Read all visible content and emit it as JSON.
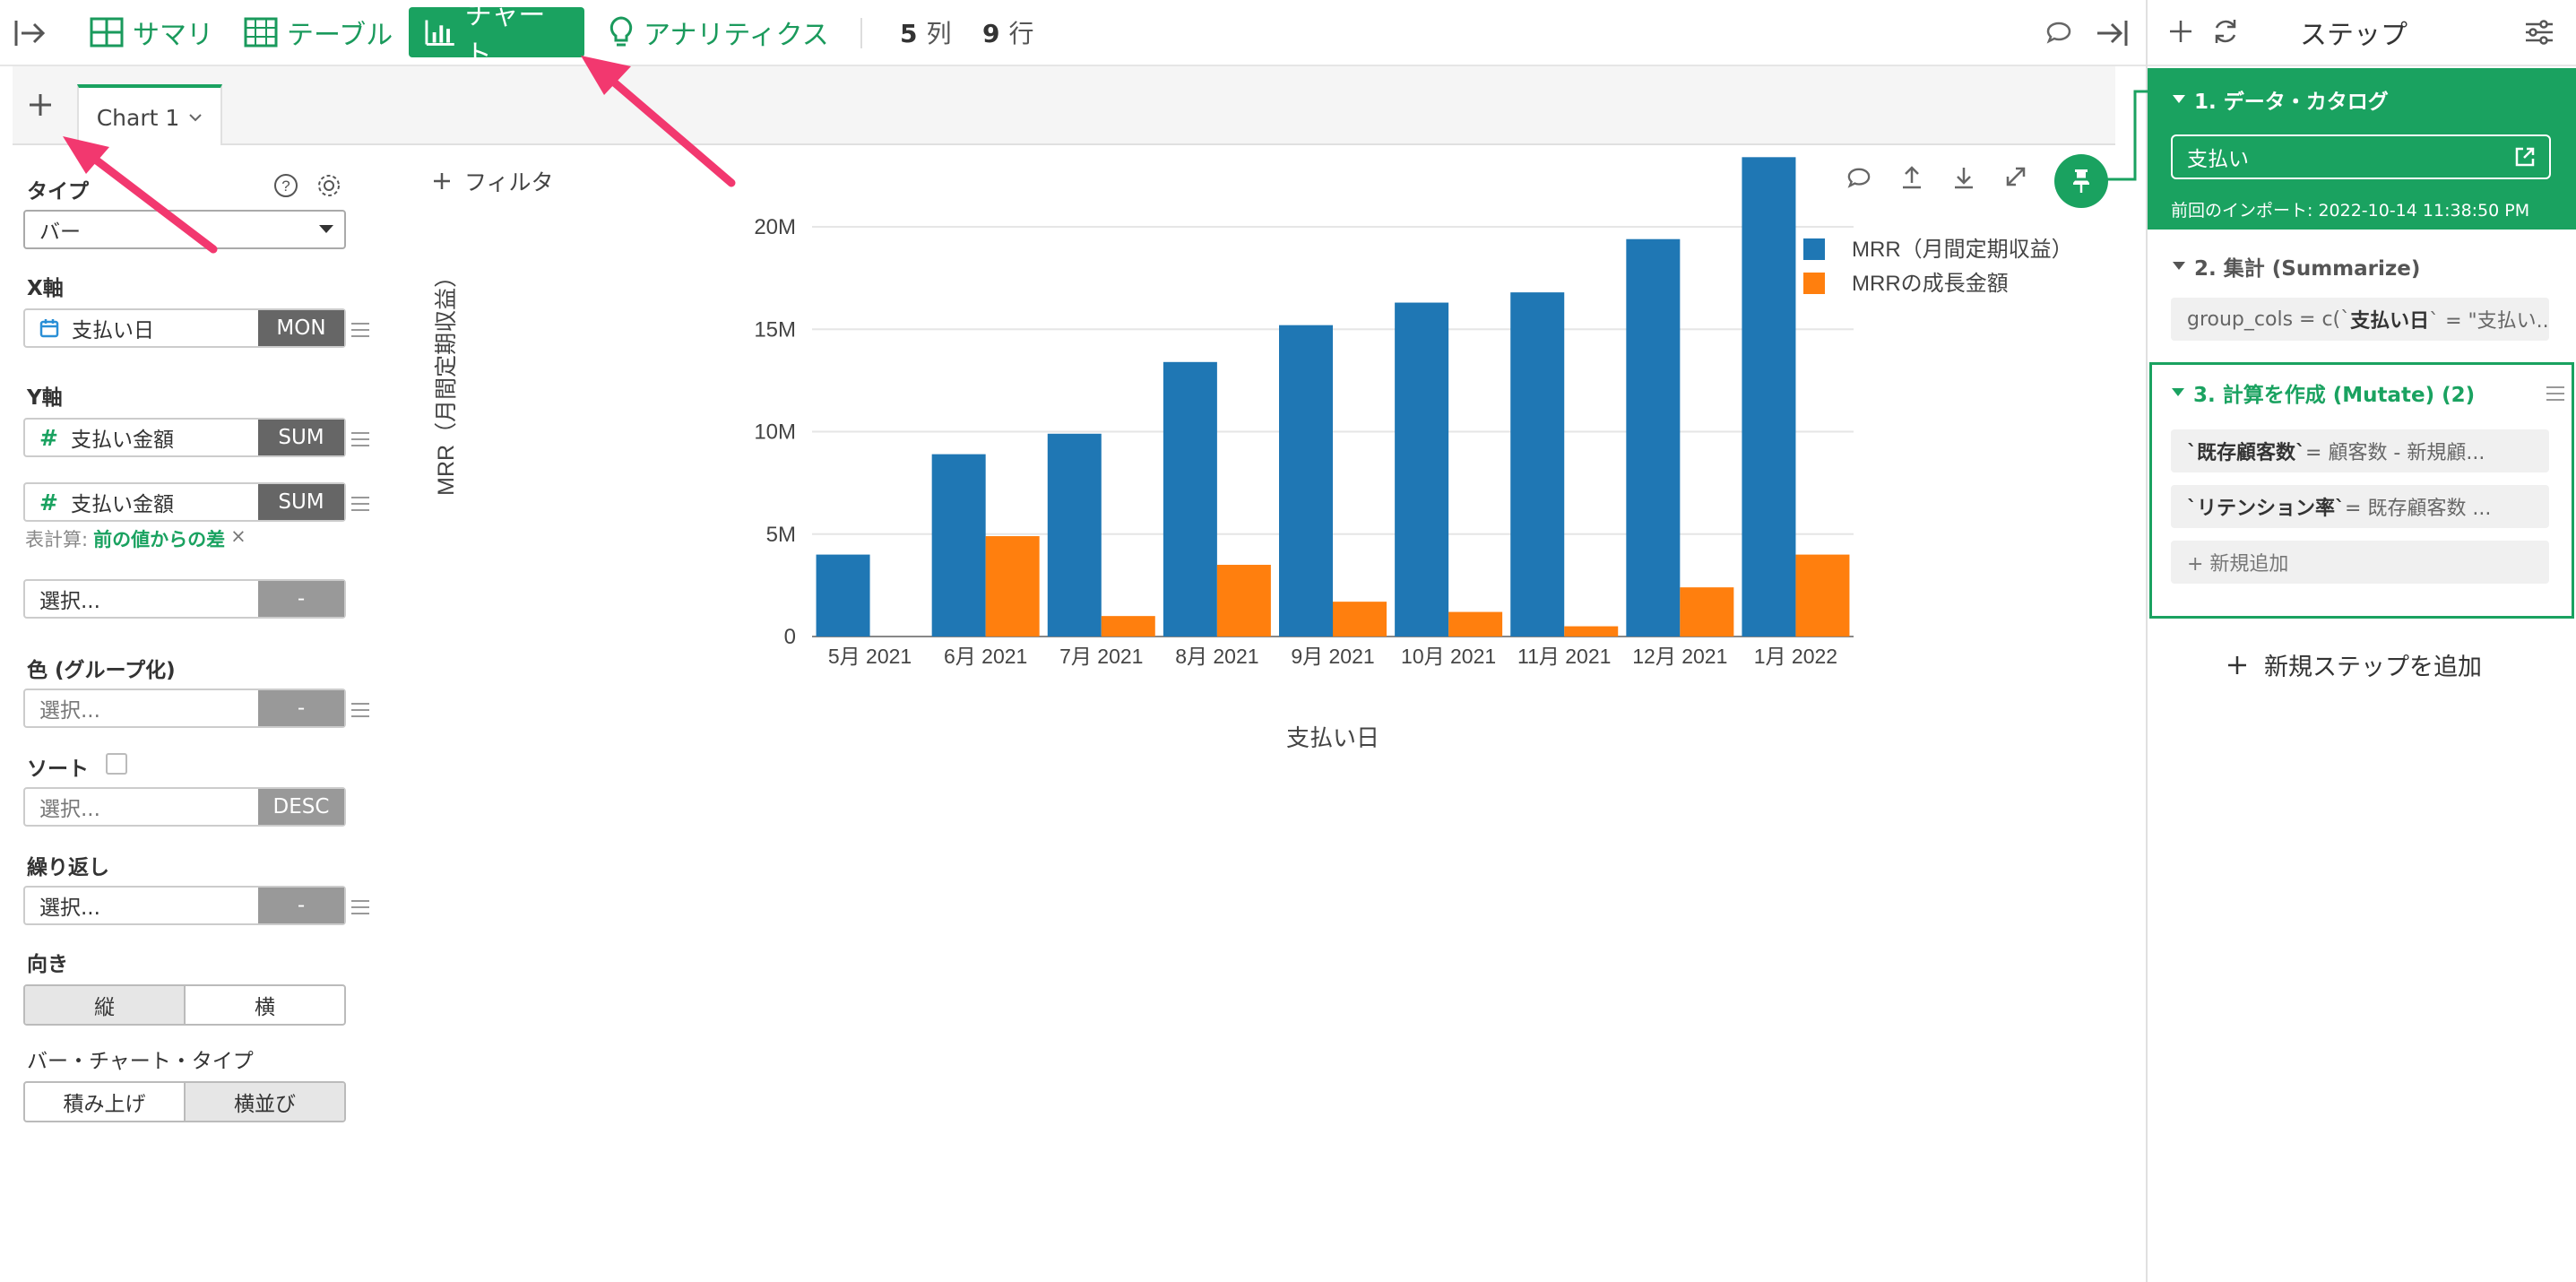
{
  "toolbar": {
    "summary": "サマリ",
    "table": "テーブル",
    "chart": "チャート",
    "analytics": "アナリティクス",
    "cols_num": "5",
    "cols_unit": "列",
    "rows_num": "9",
    "rows_unit": "行"
  },
  "chart_tab": {
    "label": "Chart 1"
  },
  "config": {
    "type_label": "タイプ",
    "type_value": "バー",
    "x_label": "X軸",
    "x_field": "支払い日",
    "x_agg": "MON",
    "y_label": "Y軸",
    "y1_field": "支払い金額",
    "y1_agg": "SUM",
    "y2_field": "支払い金額",
    "y2_agg": "SUM",
    "calc_prefix": "表計算:",
    "calc_value": "前の値からの差",
    "calc_remove": "×",
    "select_ph": "選択...",
    "dash": "-",
    "color_label": "色 (グループ化)",
    "sort_label": "ソート",
    "sort_dir": "DESC",
    "repeat_label": "繰り返し",
    "orient_label": "向き",
    "orient_v": "縦",
    "orient_h": "横",
    "bar_type_label": "バー・チャート・タイプ",
    "stacked": "積み上げ",
    "side": "横並び"
  },
  "filter": {
    "label": "フィルタ"
  },
  "steps": {
    "title": "ステップ",
    "s1": {
      "title": "1. データ・カタログ",
      "source": "支払い",
      "import": "前回のインポート: 2022-10-14 11:38:50 PM"
    },
    "s2": {
      "title": "2. 集計 (Summarize)",
      "code_a": "group_cols = c(`",
      "code_b": "支払い日",
      "code_c": "` = \"支払い..."
    },
    "s3": {
      "title": "3. 計算を作成 (Mutate) (2)",
      "c1a": "`既存顧客数`",
      "c1b": " = 顧客数 - 新規顧...",
      "c2a": "`リテンション率`",
      "c2b": " = 既存顧客数 ...",
      "add": "+ 新規追加"
    },
    "add_step": "新規ステップを追加"
  },
  "colors": {
    "accent": "#1aa260",
    "mrr": "#1f77b4",
    "growth": "#ff7f0e"
  },
  "chart_data": {
    "type": "bar",
    "categories": [
      "5月 2021",
      "6月 2021",
      "7月 2021",
      "8月 2021",
      "9月 2021",
      "10月 2021",
      "11月 2021",
      "12月 2021",
      "1月 2022"
    ],
    "series": [
      {
        "name": "MRR（月間定期収益）",
        "values": [
          4.0,
          8.9,
          9.9,
          13.4,
          15.2,
          16.3,
          16.8,
          19.4,
          23.4
        ]
      },
      {
        "name": "MRRの成長金額",
        "values": [
          0,
          4.9,
          1.0,
          3.5,
          1.7,
          1.2,
          0.5,
          2.4,
          4.0
        ]
      }
    ],
    "xlabel": "支払い日",
    "ylabel": "MRR（月間定期収益）",
    "yticks": [
      "0",
      "5M",
      "10M",
      "15M",
      "20M"
    ],
    "ylim": [
      0,
      25
    ],
    "grid": true,
    "legend": "top-right"
  }
}
